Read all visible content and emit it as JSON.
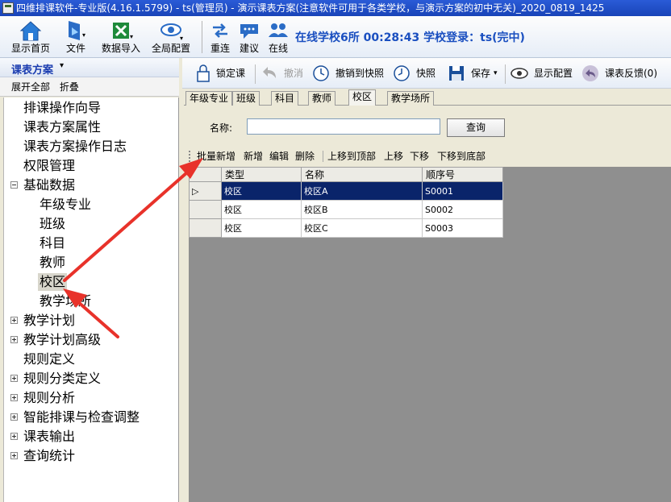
{
  "window": {
    "title": "四维排课软件-专业版(4.16.1.5799) - ts(管理员) - 演示课表方案(注意软件可用于各类学校，与演示方案的初中无关)_2020_0819_1425"
  },
  "main_toolbar": {
    "home": "显示首页",
    "file": "文件",
    "import": "数据导入",
    "global_config": "全局配置",
    "reconnect": "重连",
    "suggest": "建议",
    "online": "在线",
    "status": "在线学校6所   00:28:43  学校登录：ts(完中)"
  },
  "left_panel": {
    "header": "课表方案",
    "expand_all": "展开全部",
    "collapse": "折叠",
    "tree": [
      {
        "label": "排课操作向导"
      },
      {
        "label": "课表方案属性"
      },
      {
        "label": "课表方案操作日志"
      },
      {
        "label": "权限管理"
      },
      {
        "label": "基础数据"
      },
      {
        "label": "年级专业"
      },
      {
        "label": "班级"
      },
      {
        "label": "科目"
      },
      {
        "label": "教师"
      },
      {
        "label": "校区"
      },
      {
        "label": "教学场所"
      },
      {
        "label": "教学计划"
      },
      {
        "label": "教学计划高级"
      },
      {
        "label": "规则定义"
      },
      {
        "label": "规则分类定义"
      },
      {
        "label": "规则分析"
      },
      {
        "label": "智能排课与检查调整"
      },
      {
        "label": "课表输出"
      },
      {
        "label": "查询统计"
      }
    ]
  },
  "right_toolbar": {
    "lock": "锁定课",
    "undo": "撤消",
    "undo_snapshot": "撤销到快照",
    "snapshot": "快照",
    "save": "保存",
    "display_config": "显示配置",
    "feedback": "课表反馈(0)"
  },
  "tabs": [
    "年级专业",
    "班级",
    "科目",
    "教师",
    "校区",
    "教学场所"
  ],
  "search": {
    "label": "名称:",
    "value": "",
    "button": "查询"
  },
  "grid_toolbar": {
    "batch_add": "批量新增",
    "add": "新增",
    "edit": "编辑",
    "delete": "删除",
    "move_top": "上移到顶部",
    "move_up": "上移",
    "move_down": "下移",
    "move_bottom": "下移到底部"
  },
  "grid": {
    "columns": [
      "类型",
      "名称",
      "顺序号"
    ],
    "rows": [
      {
        "type": "校区",
        "name": "校区A",
        "order": "S0001"
      },
      {
        "type": "校区",
        "name": "校区B",
        "order": "S0002"
      },
      {
        "type": "校区",
        "name": "校区C",
        "order": "S0003"
      }
    ]
  },
  "colors": {
    "titlebar": "#1944b8",
    "status_text": "#1a4fc0",
    "selected_row": "#0a246a",
    "arrow": "#e8322a"
  }
}
